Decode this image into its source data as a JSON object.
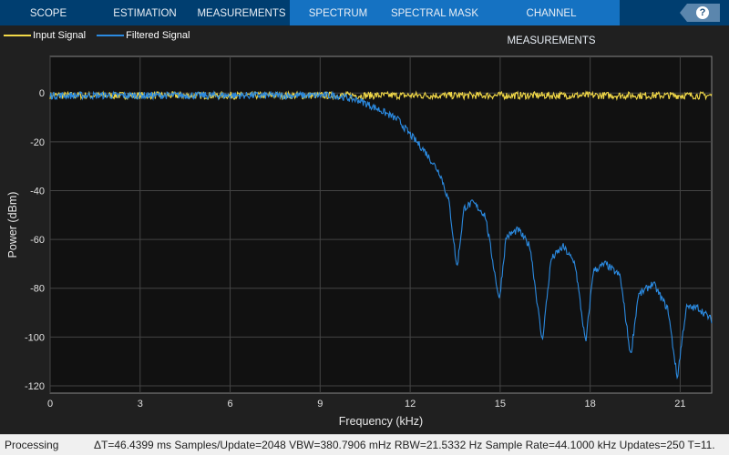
{
  "toolbar": {
    "tabs": [
      "SCOPE",
      "ESTIMATION",
      "MEASUREMENTS",
      "SPECTRUM",
      "SPECTRAL MASK",
      "CHANNEL MEASUREMENTS"
    ],
    "help": "?"
  },
  "status": {
    "state": "Processing",
    "info": "ΔT=46.4399 ms  Samples/Update=2048  VBW=380.7906 mHz  RBW=21.5332 Hz  Sample Rate=44.1000 kHz  Updates=250  T=11."
  },
  "chart_data": {
    "type": "line",
    "title": "",
    "xlabel": "Frequency (kHz)",
    "ylabel": "Power (dBm)",
    "xlim": [
      0,
      22.05
    ],
    "ylim": [
      -123,
      15
    ],
    "grid": true,
    "legend": "top-left",
    "xticks": [
      0,
      3,
      6,
      9,
      12,
      15,
      18,
      21
    ],
    "yticks": [
      0,
      -20,
      -40,
      -60,
      -80,
      -100,
      -120
    ],
    "series": [
      {
        "name": "Input Signal",
        "color": "#f2d948",
        "x": [
          0,
          22.05
        ],
        "y": [
          -1,
          -1
        ],
        "noise_db": 1.5
      },
      {
        "name": "Filtered Signal",
        "color": "#2b8ae0",
        "noise_db": 1.5,
        "x": [
          0,
          9.5,
          10.3,
          11,
          11.6,
          12,
          12.5,
          13,
          13.3,
          13.56,
          13.8,
          14.1,
          14.5,
          14.97,
          15.2,
          15.6,
          16.0,
          16.4,
          16.7,
          17.1,
          17.5,
          17.85,
          18.1,
          18.5,
          19.0,
          19.35,
          19.6,
          20.1,
          20.6,
          20.9,
          21.2,
          21.6,
          22.05
        ],
        "y": [
          -1,
          -1,
          -3,
          -7,
          -11,
          -17,
          -24,
          -33,
          -45,
          -72,
          -47,
          -45,
          -50,
          -85,
          -59,
          -56,
          -63,
          -102,
          -68,
          -63,
          -70,
          -103,
          -73,
          -70,
          -75,
          -108,
          -83,
          -78,
          -89,
          -117,
          -88,
          -88,
          -93
        ]
      }
    ]
  }
}
